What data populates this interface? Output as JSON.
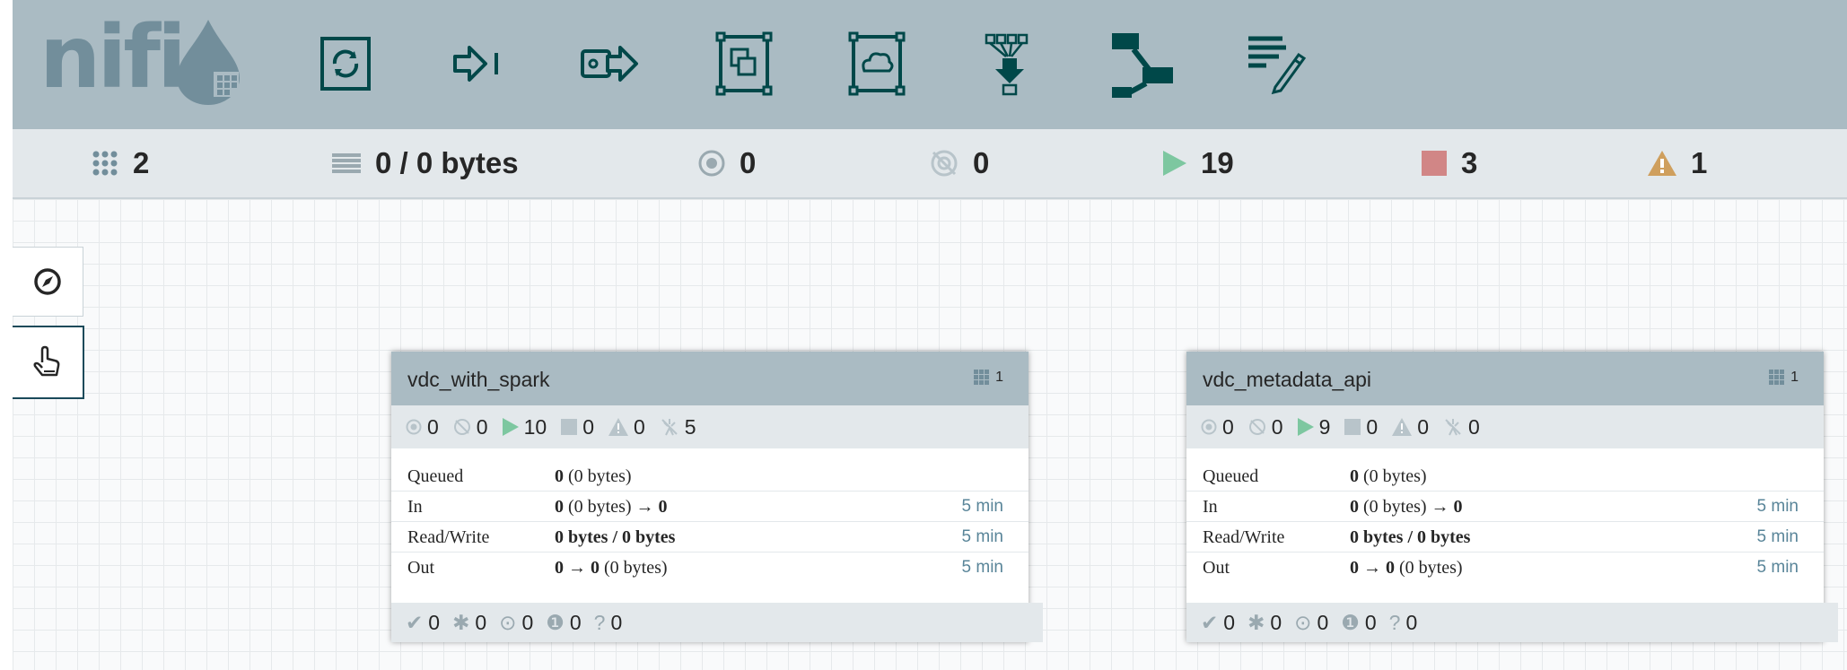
{
  "toolbar": {
    "logo_text": "nifi",
    "tools": [
      "processor",
      "input-port",
      "output-port",
      "process-group",
      "remote-process-group",
      "funnel",
      "template",
      "label"
    ]
  },
  "status": {
    "transmitting": "2",
    "queued": "0 / 0 bytes",
    "running_remote": "0",
    "stopped_remote": "0",
    "running": "19",
    "stopped": "3",
    "invalid": "1"
  },
  "colors": {
    "running": "#7dc7a0",
    "stopped": "#d18686",
    "invalid": "#cf9f5d",
    "header": "#aabbc3"
  },
  "groups": [
    {
      "name": "vdc_with_spark",
      "count": "1",
      "stats": {
        "transmitting": "0",
        "not_transmitting": "0",
        "running": "10",
        "stopped": "0",
        "invalid": "0",
        "disabled": "5"
      },
      "queued_key": "Queued",
      "queued": "0",
      "queued_bytes": "(0 bytes)",
      "in_key": "In",
      "in_count": "0",
      "in_bytes": "(0 bytes)",
      "in_arrow": "→",
      "in_out": "0",
      "in_time": "5 min",
      "rw_key": "Read/Write",
      "rw": "0 bytes / 0 bytes",
      "rw_time": "5 min",
      "out_key": "Out",
      "out_a": "0",
      "out_arrow": "→",
      "out_b": "0",
      "out_bytes": "(0 bytes)",
      "out_time": "5 min",
      "footer": {
        "up_to_date": "0",
        "locally_modified": "0",
        "stale": "0",
        "errors": "0",
        "unknown": "0"
      }
    },
    {
      "name": "vdc_metadata_api",
      "count": "1",
      "stats": {
        "transmitting": "0",
        "not_transmitting": "0",
        "running": "9",
        "stopped": "0",
        "invalid": "0",
        "disabled": "0"
      },
      "queued_key": "Queued",
      "queued": "0",
      "queued_bytes": "(0 bytes)",
      "in_key": "In",
      "in_count": "0",
      "in_bytes": "(0 bytes)",
      "in_arrow": "→",
      "in_out": "0",
      "in_time": "5 min",
      "rw_key": "Read/Write",
      "rw": "0 bytes / 0 bytes",
      "rw_time": "5 min",
      "out_key": "Out",
      "out_a": "0",
      "out_arrow": "→",
      "out_b": "0",
      "out_bytes": "(0 bytes)",
      "out_time": "5 min",
      "footer": {
        "up_to_date": "0",
        "locally_modified": "0",
        "stale": "0",
        "errors": "0",
        "unknown": "0"
      }
    }
  ]
}
